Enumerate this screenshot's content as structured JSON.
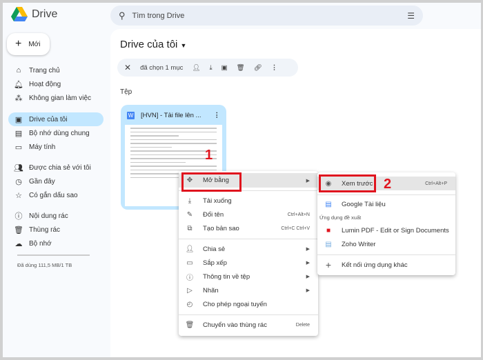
{
  "app": {
    "name": "Drive"
  },
  "search": {
    "placeholder": "Tìm trong Drive"
  },
  "new_button": "Mới",
  "sidebar": {
    "items": [
      {
        "label": "Trang chủ",
        "icon": "home-icon"
      },
      {
        "label": "Hoạt động",
        "icon": "bell-icon"
      },
      {
        "label": "Không gian làm việc",
        "icon": "workspaces-icon"
      },
      {
        "label": "Drive của tôi",
        "icon": "my-drive-icon",
        "active": true
      },
      {
        "label": "Bộ nhớ dùng chung",
        "icon": "shared-drives-icon"
      },
      {
        "label": "Máy tính",
        "icon": "computer-icon"
      },
      {
        "label": "Được chia sẻ với tôi",
        "icon": "people-icon"
      },
      {
        "label": "Gần đây",
        "icon": "clock-icon"
      },
      {
        "label": "Có gắn dấu sao",
        "icon": "star-icon"
      },
      {
        "label": "Nội dung rác",
        "icon": "spam-icon"
      },
      {
        "label": "Thùng rác",
        "icon": "trash-icon"
      },
      {
        "label": "Bộ nhớ",
        "icon": "cloud-icon"
      }
    ],
    "storage": "Đã dùng 111,5 MB/1 TB"
  },
  "main": {
    "title": "Drive của tôi",
    "toolbar": {
      "selected": "đã chọn 1 mục"
    },
    "section": "Tệp",
    "file": {
      "name": "[HVN] - Tải file lên ..."
    }
  },
  "context_menu": {
    "items": [
      {
        "label": "Mở bằng",
        "submenu": true
      },
      {
        "label": "Tải xuống"
      },
      {
        "label": "Đổi tên",
        "shortcut": "Ctrl+Alt+N"
      },
      {
        "label": "Tạo bản sao",
        "shortcut": "Ctrl+C Ctrl+V"
      },
      {
        "label": "Chia sẻ",
        "submenu": true
      },
      {
        "label": "Sắp xếp",
        "submenu": true
      },
      {
        "label": "Thông tin về tệp",
        "submenu": true
      },
      {
        "label": "Nhãn",
        "submenu": true
      },
      {
        "label": "Cho phép ngoại tuyến"
      },
      {
        "label": "Chuyển vào thùng rác",
        "shortcut": "Delete"
      }
    ]
  },
  "submenu": {
    "preview": {
      "label": "Xem trước",
      "shortcut": "Ctrl+Alt+P"
    },
    "google_docs": "Google Tài liệu",
    "suggested_header": "Ứng dụng đề xuất",
    "lumin": "Lumin PDF - Edit or Sign Documents",
    "zoho": "Zoho Writer",
    "connect": "Kết nối ứng dụng khác"
  },
  "annotations": {
    "step1": "1",
    "step2": "2"
  },
  "colors": {
    "accent": "#c2e7ff",
    "annotation": "#e0141e"
  }
}
